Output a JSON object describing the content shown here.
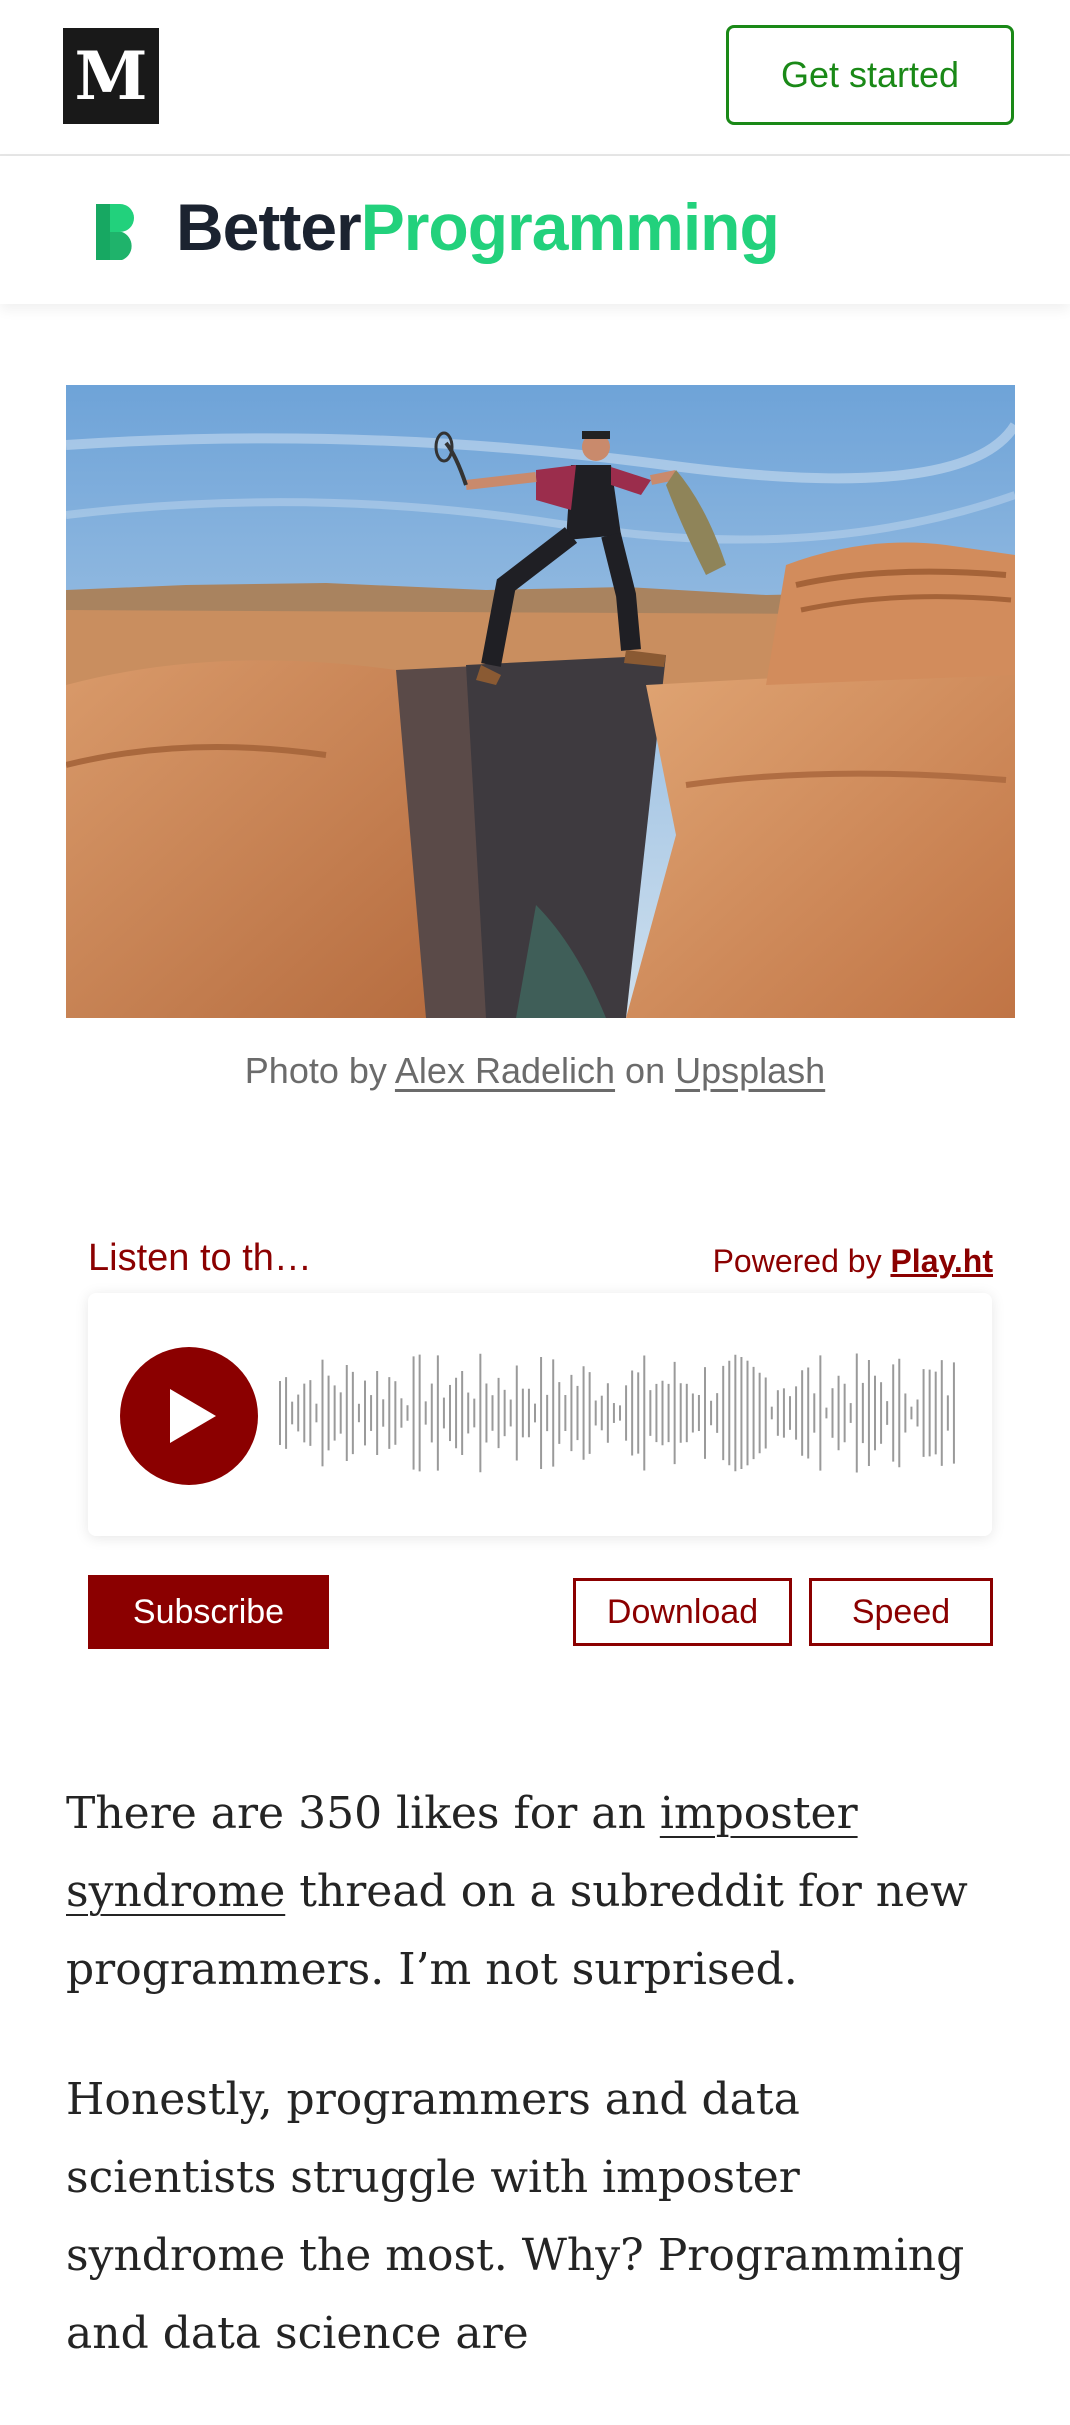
{
  "header": {
    "logo_letter": "M",
    "get_started_label": "Get started"
  },
  "publication": {
    "name_part1": "Better",
    "name_part2": "Programming",
    "brand_color": "#22d17c"
  },
  "hero": {
    "caption_prefix": "Photo by ",
    "caption_author": "Alex Radelich",
    "caption_middle": " on ",
    "caption_source": "Upsplash"
  },
  "audio": {
    "title": "Listen to th…",
    "powered_prefix": "Powered by ",
    "powered_brand": "Play.ht",
    "accent_color": "#8b0000",
    "subscribe_label": "Subscribe",
    "download_label": "Download",
    "speed_label": "Speed"
  },
  "article": {
    "p1_before": "There are 350 likes for an ",
    "p1_link": "imposter syndrome",
    "p1_after": " thread on a subreddit for new programmers. I’m not surprised.",
    "p2": "Honestly, programmers and data scientists struggle with imposter syndrome the most. Why? Programming and data science are"
  }
}
